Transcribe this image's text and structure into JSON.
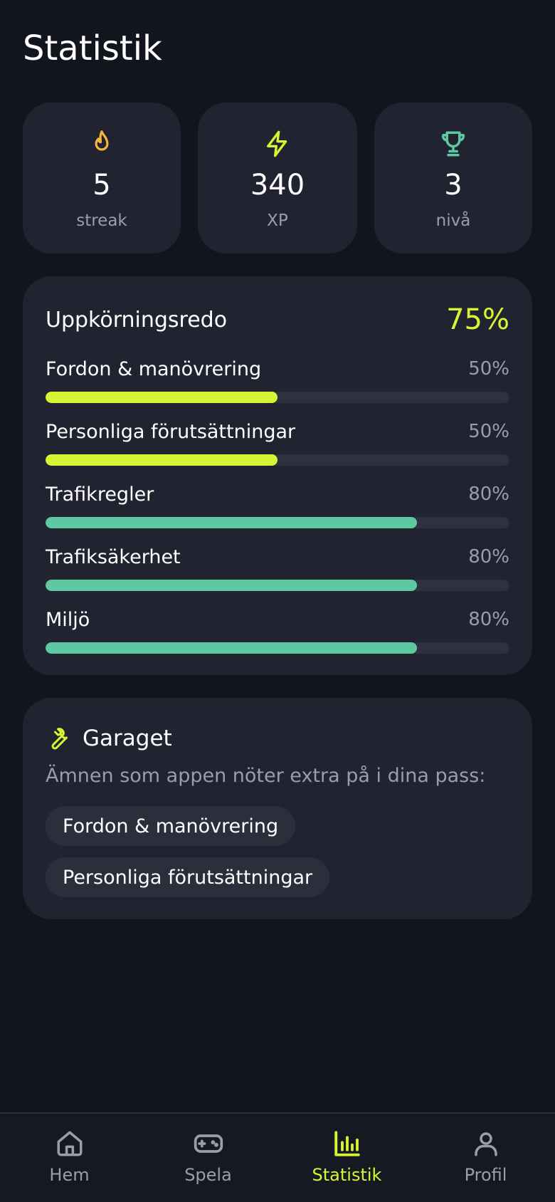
{
  "page": {
    "title": "Statistik"
  },
  "stats": [
    {
      "icon": "flame-icon",
      "value": "5",
      "label": "streak",
      "color": "#f5b83d"
    },
    {
      "icon": "lightning-icon",
      "value": "340",
      "label": "XP",
      "color": "#d7f532"
    },
    {
      "icon": "trophy-icon",
      "value": "3",
      "label": "nivå",
      "color": "#5ec9a0"
    }
  ],
  "readiness": {
    "title": "Uppkörningsredo",
    "percent": "75%",
    "categories": [
      {
        "label": "Fordon & manövrering",
        "percent_text": "50%",
        "progress": 0.5,
        "color": "#d7f532"
      },
      {
        "label": "Personliga förutsättningar",
        "percent_text": "50%",
        "progress": 0.5,
        "color": "#d7f532"
      },
      {
        "label": "Trafikregler",
        "percent_text": "80%",
        "progress": 0.8,
        "color": "#5ec9a0"
      },
      {
        "label": "Trafiksäkerhet",
        "percent_text": "80%",
        "progress": 0.8,
        "color": "#5ec9a0"
      },
      {
        "label": "Miljö",
        "percent_text": "80%",
        "progress": 0.8,
        "color": "#5ec9a0"
      }
    ]
  },
  "garage": {
    "icon": "wrench-icon",
    "title": "Garaget",
    "description": "Ämnen som appen nöter extra på i dina pass:",
    "chips": [
      "Fordon & manövrering",
      "Personliga förutsättningar"
    ]
  },
  "nav": {
    "active": "Statistik",
    "items": [
      {
        "icon": "home-icon",
        "label": "Hem"
      },
      {
        "icon": "gamepad-icon",
        "label": "Spela"
      },
      {
        "icon": "bar-chart-icon",
        "label": "Statistik"
      },
      {
        "icon": "user-icon",
        "label": "Profil"
      }
    ]
  },
  "colors": {
    "accent": "#d7f532",
    "teal": "#5ec9a0",
    "flame": "#f5b83d",
    "muted": "#9a9ea9"
  }
}
